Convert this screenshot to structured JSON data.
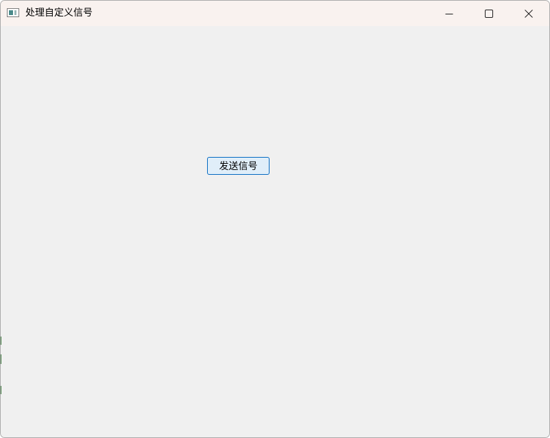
{
  "window": {
    "title": "处理自定义信号",
    "controls": {
      "minimize_icon": "minimize-icon",
      "maximize_icon": "maximize-icon",
      "close_icon": "close-icon"
    }
  },
  "main": {
    "send_button_label": "发送信号"
  },
  "colors": {
    "titlebar_bg": "#f9f2ef",
    "client_bg": "#f0f0f0",
    "button_border": "#0067c0",
    "button_bg": "#e0eef9"
  }
}
